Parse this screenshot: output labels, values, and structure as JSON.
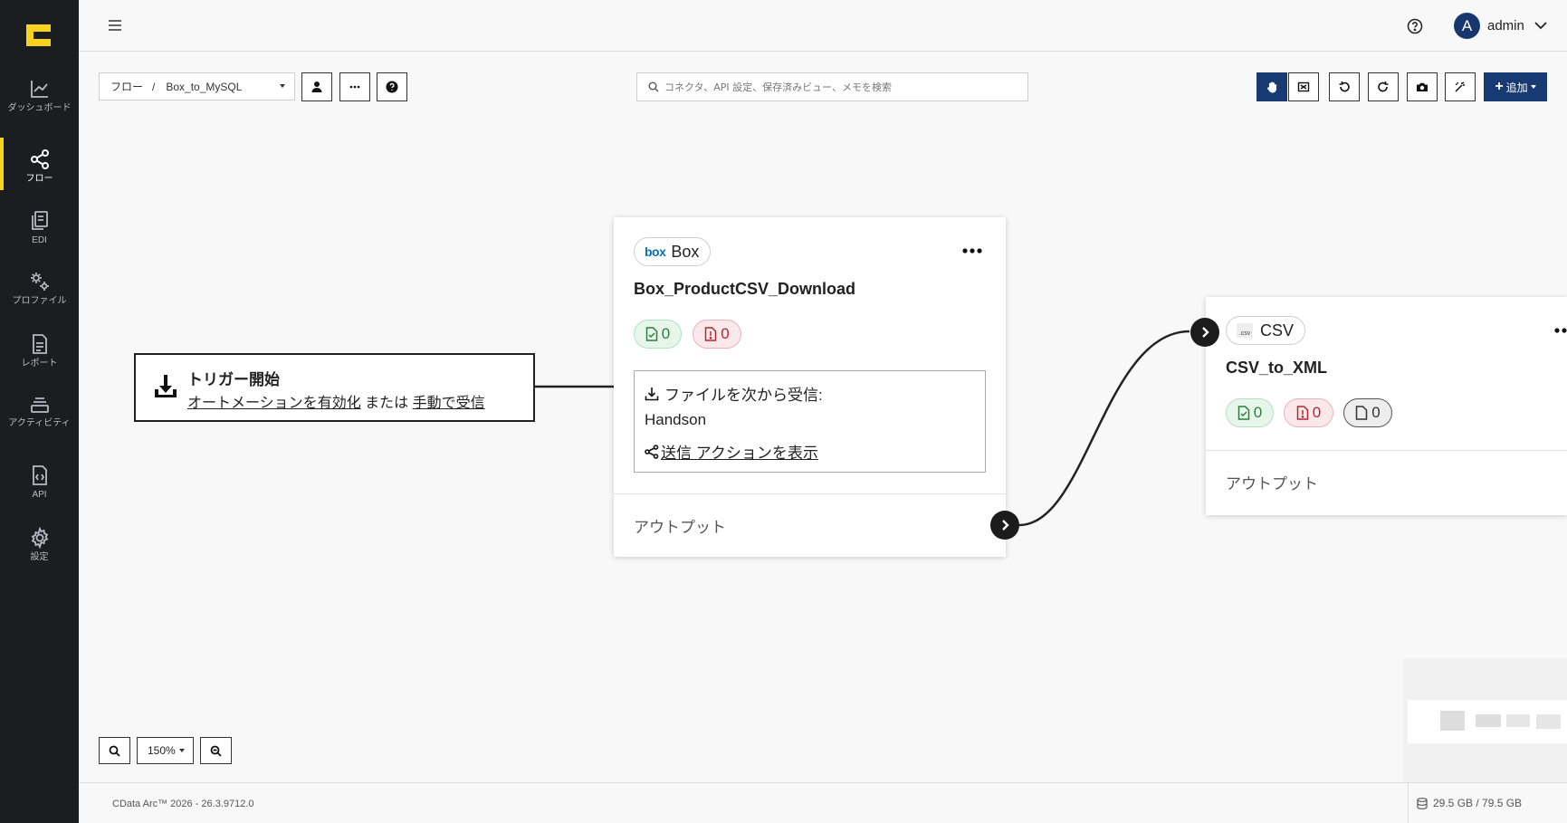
{
  "sidebar": {
    "items": [
      {
        "label": "ダッシュボード",
        "icon": "chart-line-icon"
      },
      {
        "label": "フロー",
        "icon": "share-nodes-icon",
        "active": true
      },
      {
        "label": "EDI",
        "icon": "documents-icon"
      },
      {
        "label": "プロファイル",
        "icon": "gears-icon"
      },
      {
        "label": "レポート",
        "icon": "report-icon"
      },
      {
        "label": "アクティビティ",
        "icon": "layers-icon"
      },
      {
        "label": "API",
        "icon": "api-file-icon"
      },
      {
        "label": "設定",
        "icon": "gear-icon"
      }
    ]
  },
  "header": {
    "avatar_letter": "A",
    "user_name": "admin"
  },
  "toolbar": {
    "breadcrumb_root": "フロー",
    "breadcrumb_separator": "/",
    "breadcrumb_current": "Box_to_MySQL",
    "search_placeholder": "コネクタ、API 設定、保存済みビュー、メモを検索",
    "add_label": "追加"
  },
  "trigger": {
    "title": "トリガー開始",
    "text_part1": "オートメーションを",
    "link_enable": "有効化",
    "text_part2": " または ",
    "link_manual": "手動で受信"
  },
  "box_card": {
    "connector_name": "Box",
    "connector_logo": "box",
    "title": "Box_ProductCSV_Download",
    "success_count": "0",
    "error_count": "0",
    "receive_label": "ファイルを次から受信:",
    "receive_source": "Handson",
    "send_link_prefix": "送信",
    "send_link_suffix": " アクションを表示",
    "output_label": "アウトプット"
  },
  "csv_card": {
    "connector_name": "CSV",
    "connector_logo": ".csv",
    "title": "CSV_to_XML",
    "success_count": "0",
    "error_count": "0",
    "pending_count": "0",
    "output_label": "アウトプット"
  },
  "zoom": {
    "level": "150%"
  },
  "footer": {
    "version": "CData Arc™ 2026 - 26.3.9712.0",
    "storage": "29.5 GB / 79.5 GB"
  },
  "colors": {
    "sidebar_bg": "#1b1d20",
    "accent_yellow": "#f7d21e",
    "primary_blue": "#173a73",
    "success_green": "#2d7c3e",
    "error_red": "#b32534"
  }
}
